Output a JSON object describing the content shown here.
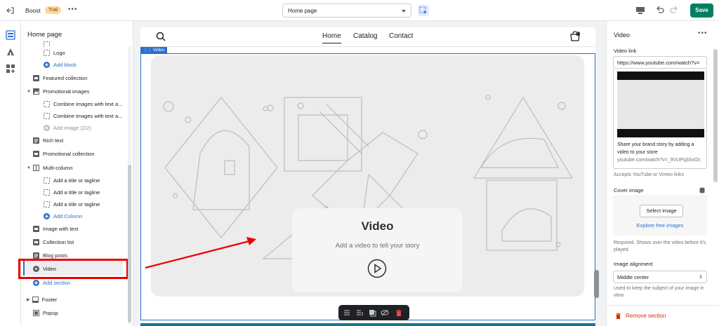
{
  "topbar": {
    "app_name": "Boost",
    "badge": "Trial",
    "more": "•••",
    "page_select": "Home page",
    "save_label": "Save"
  },
  "sidebar": {
    "title": "Home page",
    "items": [
      {
        "label": "Logo"
      },
      {
        "label": "Add block"
      },
      {
        "label": "Featured collection"
      },
      {
        "label": "Promotional images"
      },
      {
        "label": "Combine images with text a..."
      },
      {
        "label": "Combine images with text a..."
      },
      {
        "label": "Add Image (2/2)"
      },
      {
        "label": "Rich text"
      },
      {
        "label": "Promotional collection"
      },
      {
        "label": "Multi-column"
      },
      {
        "label": "Add a title or tagline"
      },
      {
        "label": "Add a title or tagline"
      },
      {
        "label": "Add a title or tagline"
      },
      {
        "label": "Add Column"
      },
      {
        "label": "Image with text"
      },
      {
        "label": "Collection list"
      },
      {
        "label": "Blog posts"
      },
      {
        "label": "Video"
      },
      {
        "label": "Add section"
      },
      {
        "label": "Footer"
      },
      {
        "label": "Popup"
      }
    ]
  },
  "store": {
    "nav": [
      "Home",
      "Catalog",
      "Contact"
    ],
    "cart_count": "0",
    "video_tag": "Video",
    "video_title": "Video",
    "video_subtitle": "Add a video to tell your story"
  },
  "settings": {
    "title": "Video",
    "more": "•••",
    "video_link_label": "Video link",
    "video_link_value": "https://www.youtube.com/watch?v=",
    "card_text": "Share your brand story by adding a video to your store",
    "card_url": "youtube.com/watch?v=_9VUPq3SxOc",
    "link_help": "Accepts YouTube or Vimeo links",
    "cover_label": "Cover image",
    "select_image": "Select image",
    "explore": "Explore free images",
    "cover_help": "Required. Shows over the video before it's played.",
    "alignment_label": "Image alignment",
    "alignment_value": "Middle center",
    "alignment_help": "Used to keep the subject of your image in view",
    "remove_label": "Remove section"
  },
  "colors": {
    "accent": "#2c6ecb",
    "save": "#008060",
    "danger": "#d72c0d",
    "highlight_box": "#ee0000",
    "annotation_arrow": "#ee0000"
  }
}
